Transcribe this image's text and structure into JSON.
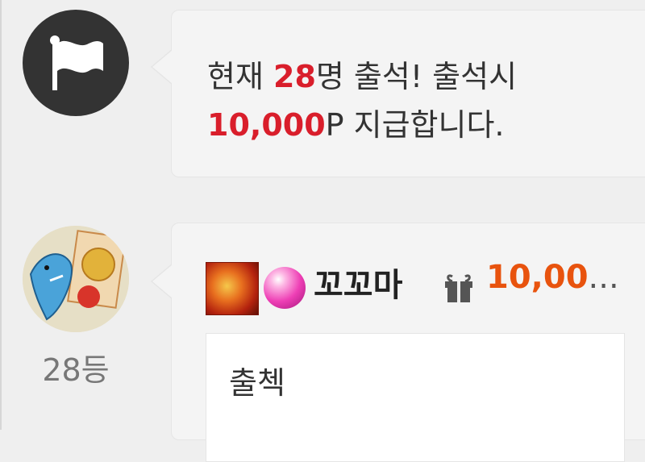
{
  "attendance_notice": {
    "line1_prefix": "현재 ",
    "count": "28",
    "line1_suffix": "명 출석! 출석시",
    "points": "10,000",
    "line2_suffix": "P 지급합니다."
  },
  "entry": {
    "rank": "28등",
    "username": "꼬꼬마",
    "points_awarded": "10,00",
    "ellipsis": "...",
    "comment": "출첵"
  },
  "colors": {
    "highlight_red": "#d91e2b",
    "points_orange": "#e8530e",
    "flag_icon_bg": "#333333"
  },
  "icons": {
    "notice": "flag-icon",
    "level": "level-badge-icon",
    "orb": "pink-orb-icon",
    "gift": "gift-icon"
  }
}
